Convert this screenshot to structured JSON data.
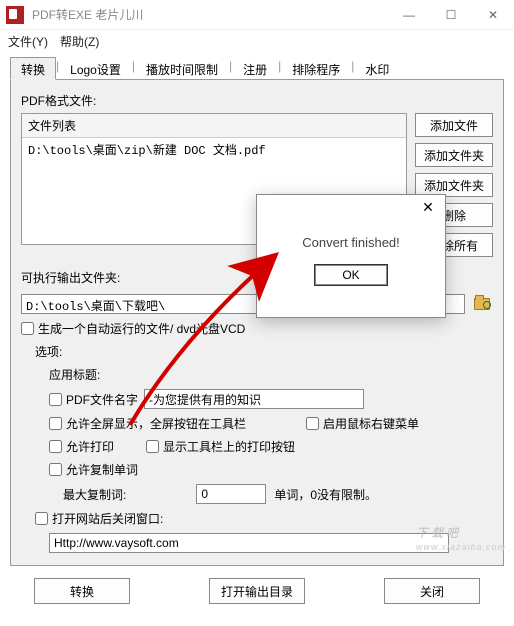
{
  "titlebar": {
    "title": "PDF转EXE    老片儿川"
  },
  "menubar": {
    "file": "文件(Y)",
    "help": "帮助(Z)"
  },
  "tabs": {
    "items": [
      {
        "label": "转换",
        "active": true
      },
      {
        "label": "Logo设置"
      },
      {
        "label": "播放时间限制"
      },
      {
        "label": "注册"
      },
      {
        "label": "排除程序"
      },
      {
        "label": "水印"
      }
    ]
  },
  "pdf_section": {
    "label": "PDF格式文件:",
    "list_header": "文件列表",
    "rows": [
      "D:\\tools\\桌面\\zip\\新建 DOC 文档.pdf"
    ]
  },
  "side_buttons": {
    "add_file": "添加文件",
    "add_folder": "添加文件夹",
    "add_folder2": "添加文件夹",
    "delete": "删除",
    "delete_all": "删除所有"
  },
  "output": {
    "label": "可执行输出文件夹:",
    "path": "D:\\tools\\桌面\\下载吧\\"
  },
  "autorun": {
    "label": "生成一个自动运行的文件/ dvd光盘VCD"
  },
  "options": {
    "label": "选项:",
    "app_title_label": "应用标题:",
    "pdf_name_label": "PDF文件名字",
    "app_title_value": "-为您提供有用的知识",
    "fullscreen_label": "允许全屏显示，全屏按钮在工具栏",
    "rightclick_label": "启用鼠标右键菜单",
    "print_label": "允许打印",
    "show_print_btn_label": "显示工具栏上的打印按钮",
    "copy_label": "允许复制单词",
    "max_copy_label": "最大复制词:",
    "max_copy_value": "0",
    "max_copy_suffix": "单词，0没有限制。",
    "close_window_label": "打开网站后关闭窗口:",
    "url": "Http://www.vaysoft.com"
  },
  "bottom_buttons": {
    "convert": "转换",
    "open_output": "打开输出目录",
    "close": "关闭"
  },
  "modal": {
    "message": "Convert finished!",
    "ok": "OK"
  },
  "watermark": {
    "main": "下载吧",
    "sub": "www.xiazaiba.com"
  }
}
